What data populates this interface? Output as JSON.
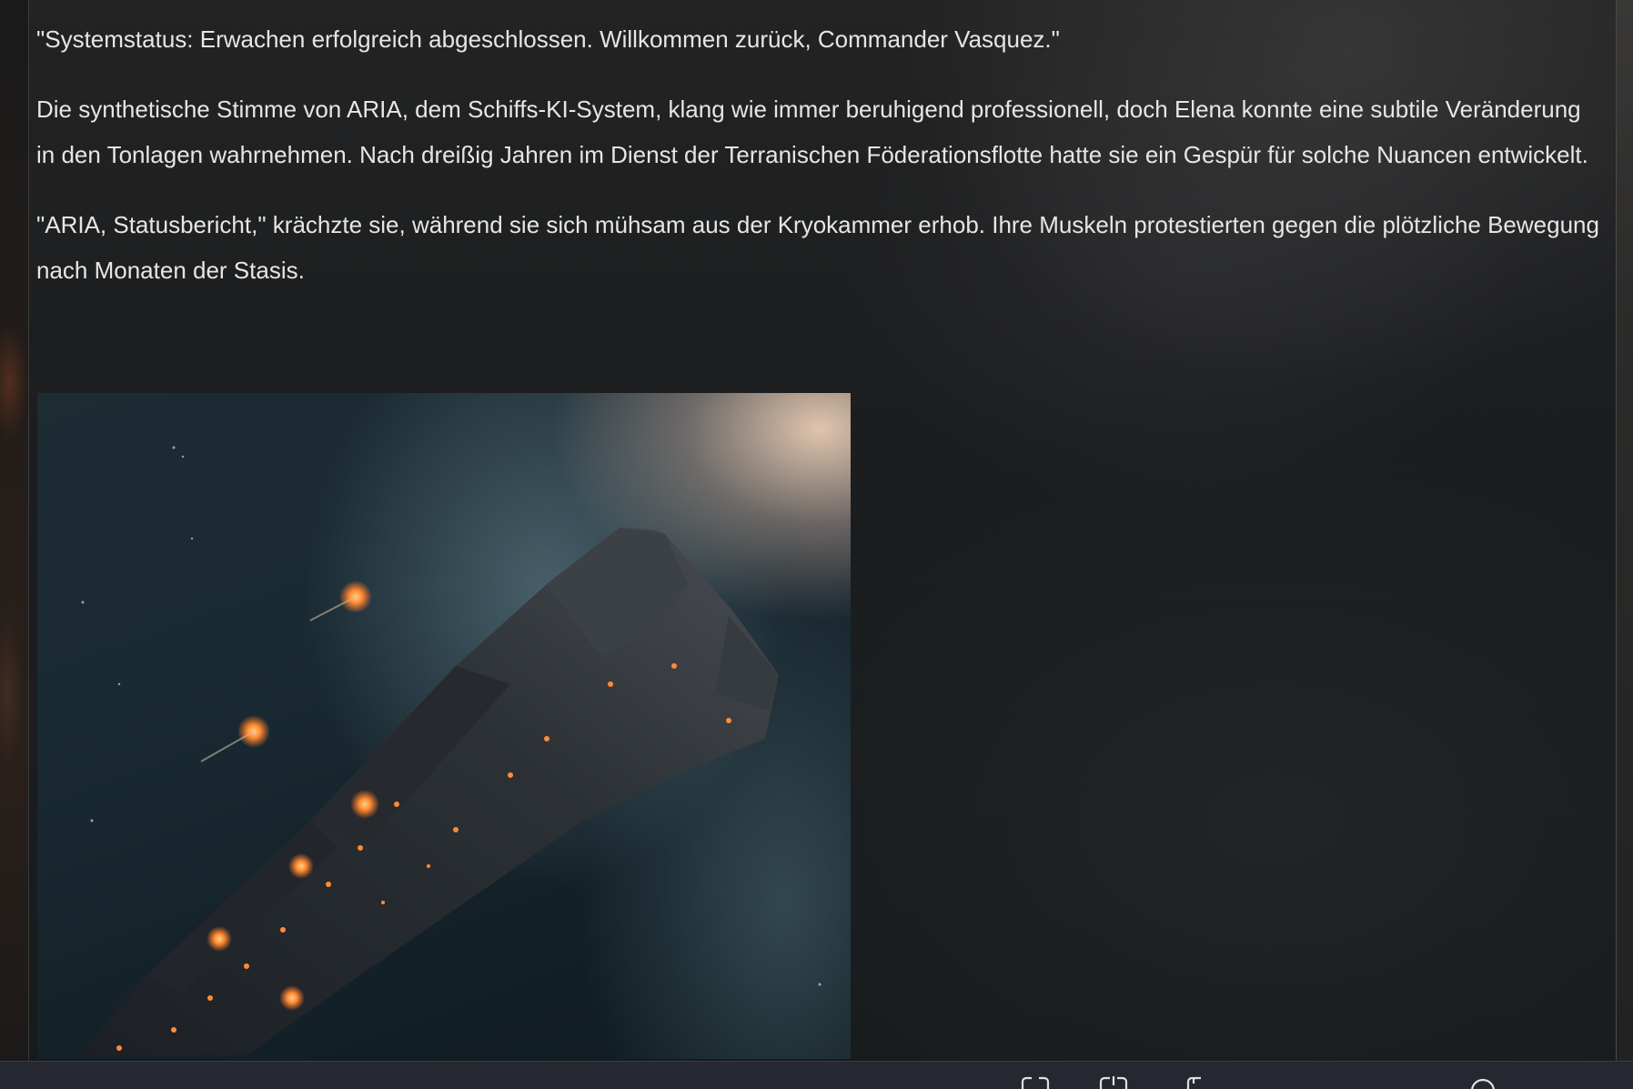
{
  "story": {
    "paragraphs": [
      "\"Systemstatus: Erwachen erfolgreich abgeschlossen. Willkommen zurück, Commander Vasquez.\"",
      "Die synthetische Stimme von ARIA, dem Schiffs-KI-System, klang wie immer beruhigend professionell, doch Elena konnte eine subtile Veränderung in den Tonlagen wahrnehmen. Nach dreißig Jahren im Dienst der Terranischen Föderationsflotte hatte sie ein Gespür für solche Nuancen entwickelt.",
      "\"ARIA, Statusbericht,\" krächzte sie, während sie sich mühsam aus der Kryokammer erhob. Ihre Muskeln protestierten gegen die plötzliche Bewegung nach Monaten der Stasis."
    ]
  },
  "image": {
    "subject": "starship-illustration"
  },
  "toolbar": {
    "icons": [
      "expand-icon",
      "edit-branch-icon",
      "copy-icon",
      "info-icon"
    ]
  }
}
